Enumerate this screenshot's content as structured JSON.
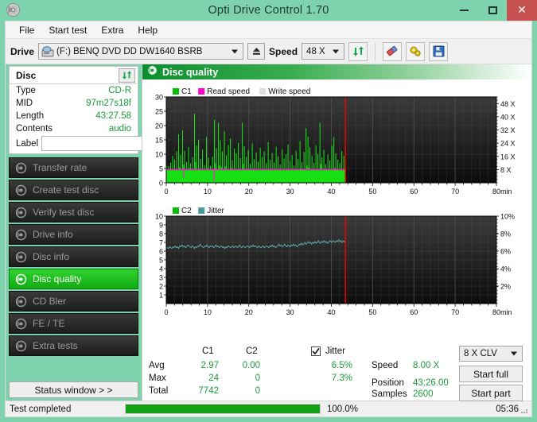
{
  "window": {
    "title": "Opti Drive Control 1.70",
    "app_icon": "disc-icon",
    "minimize": "minimize-icon",
    "maximize": "maximize-icon",
    "close": "close-icon"
  },
  "menu": {
    "items": [
      {
        "label": "File"
      },
      {
        "label": "Start test"
      },
      {
        "label": "Extra"
      },
      {
        "label": "Help"
      }
    ]
  },
  "toolbar": {
    "drive_label": "Drive",
    "drive_value": "(F:)   BENQ DVD DD DW1640 BSRB",
    "eject_icon": "eject-icon",
    "speed_label": "Speed",
    "speed_value": "48 X",
    "refresh_icon": "refresh-icon",
    "erase_icon": "eraser-icon",
    "settings_icon": "gears-icon",
    "save_icon": "save-icon"
  },
  "disc_panel": {
    "title": "Disc",
    "refresh_icon": "refresh-icon",
    "rows": [
      {
        "key": "Type",
        "value": "CD-R"
      },
      {
        "key": "MID",
        "value": "97m27s18f"
      },
      {
        "key": "Length",
        "value": "43:27.58"
      },
      {
        "key": "Contents",
        "value": "audio"
      }
    ],
    "label_key": "Label",
    "label_value": "",
    "label_placeholder": "",
    "label_button_icon": "cd-icon"
  },
  "nav": {
    "items": [
      {
        "label": "Transfer rate",
        "icon": "disc-icon",
        "active": false
      },
      {
        "label": "Create test disc",
        "icon": "disc-icon",
        "active": false
      },
      {
        "label": "Verify test disc",
        "icon": "disc-icon",
        "active": false
      },
      {
        "label": "Drive info",
        "icon": "disc-icon",
        "active": false
      },
      {
        "label": "Disc info",
        "icon": "disc-icon",
        "active": false
      },
      {
        "label": "Disc quality",
        "icon": "disc-icon",
        "active": true
      },
      {
        "label": "CD Bler",
        "icon": "disc-icon",
        "active": false
      },
      {
        "label": "FE / TE",
        "icon": "disc-icon",
        "active": false
      },
      {
        "label": "Extra tests",
        "icon": "disc-icon",
        "active": false
      }
    ],
    "status_window_label": "Status window > >"
  },
  "section": {
    "title": "Disc quality",
    "icon": "disc-icon"
  },
  "stats": {
    "col_c1": "C1",
    "col_c2": "C2",
    "col_jitter": "Jitter",
    "jitter_checked": true,
    "rows": [
      {
        "label": "Avg",
        "c1": "2.97",
        "c2": "0.00",
        "jitter": "6.5%"
      },
      {
        "label": "Max",
        "c1": "24",
        "c2": "0",
        "jitter": "7.3%"
      },
      {
        "label": "Total",
        "c1": "7742",
        "c2": "0",
        "jitter": ""
      }
    ],
    "speed_key": "Speed",
    "speed_value": "8.00 X",
    "position_key": "Position",
    "position_value": "43:26.00",
    "samples_key": "Samples",
    "samples_value": "2600",
    "speed_select": "8 X CLV",
    "start_full": "Start full",
    "start_part": "Start part"
  },
  "statusbar": {
    "text": "Test completed",
    "progress_pct": 100,
    "progress_label": "100.0%",
    "elapsed": "05:36"
  },
  "chart_data": [
    {
      "type": "bar",
      "id": "c1-chart",
      "title": "",
      "xlabel": "min",
      "ylabel": "",
      "xlim": [
        0,
        80
      ],
      "ylim": [
        0,
        30
      ],
      "ylim_right": [
        0,
        52
      ],
      "xticks": [
        0,
        10,
        20,
        30,
        40,
        50,
        60,
        70,
        80
      ],
      "yticks": [
        0,
        5,
        10,
        15,
        20,
        25,
        30
      ],
      "yticks_right": [
        "8 X",
        "16 X",
        "24 X",
        "32 X",
        "40 X",
        "48 X"
      ],
      "yticks_right_values": [
        8,
        16,
        24,
        32,
        40,
        48
      ],
      "grid": true,
      "legend": [
        {
          "name": "C1",
          "color": "#00c000"
        },
        {
          "name": "Read speed",
          "color": "#ff00c8"
        },
        {
          "name": "Write speed",
          "color": "#e0e0e0"
        }
      ],
      "marker_x": 43.4,
      "marker_color": "#ff0000",
      "data_end_x": 43.4,
      "baseline_fill_value": 4.4,
      "read_speed_value": 8.0,
      "values": [
        6.0,
        2.1,
        5.9,
        1.8,
        7.0,
        3.2,
        9.4,
        2.6,
        8.1,
        3.0,
        11.0,
        4.2,
        17.0,
        5.4,
        9.8,
        3.1,
        18.3,
        6.4,
        11.2,
        4.0,
        7.3,
        2.8,
        12.5,
        5.1,
        6.8,
        2.2,
        9.0,
        3.4,
        24.2,
        7.2,
        13.0,
        4.6,
        15.1,
        5.0,
        8.4,
        2.9,
        11.6,
        3.8,
        6.2,
        1.9,
        16.0,
        5.2,
        8.8,
        3.3,
        5.9,
        2.0,
        9.2,
        3.0,
        22.0,
        6.8,
        12.1,
        4.4,
        21.0,
        6.1,
        14.8,
        5.5,
        11.0,
        3.6,
        18.0,
        5.8,
        9.6,
        3.1,
        13.2,
        4.7,
        15.5,
        5.2,
        7.9,
        2.4,
        12.0,
        4.1,
        10.2,
        3.5,
        14.0,
        4.8,
        8.6,
        2.7,
        21.0,
        6.6,
        12.8,
        4.3,
        9.1,
        3.0,
        11.4,
        3.9,
        6.6,
        2.2,
        13.8,
        4.9,
        8.2,
        2.8,
        10.6,
        3.4,
        7.4,
        2.5,
        12.2,
        4.0,
        9.0,
        3.1,
        11.0,
        3.7,
        6.8,
        2.3,
        14.2,
        4.6,
        8.0,
        2.6,
        10.4,
        3.5,
        7.1,
        2.4,
        12.6,
        4.2,
        9.3,
        3.0,
        6.4,
        2.1,
        11.8,
        3.8,
        8.5,
        2.9,
        10.0,
        3.3,
        13.4,
        4.5,
        7.6,
        2.5,
        9.7,
        3.2,
        6.0,
        2.0,
        11.2,
        3.7,
        8.3,
        2.7,
        14.6,
        4.9,
        7.2,
        2.4,
        10.8,
        3.6,
        19.1,
        6.0,
        16.2,
        5.3,
        12.4,
        4.1,
        9.5,
        3.1,
        7.0,
        2.3,
        13.0,
        4.4,
        10.1,
        3.4,
        21.0,
        6.5,
        8.9,
        2.9,
        11.5,
        3.8,
        6.5,
        2.1,
        9.9,
        3.2,
        7.8,
        2.6,
        12.9,
        4.3,
        16.0,
        5.2,
        10.3,
        3.4,
        8.1,
        2.7,
        6.9,
        2.2,
        11.1,
        3.6,
        9.4,
        3.0
      ]
    },
    {
      "type": "line",
      "id": "jitter-chart",
      "title": "",
      "xlabel": "min",
      "ylabel": "",
      "xlim": [
        0,
        80
      ],
      "ylim": [
        0,
        10
      ],
      "ylim_right": [
        0,
        10
      ],
      "xticks": [
        0,
        10,
        20,
        30,
        40,
        50,
        60,
        70,
        80
      ],
      "yticks": [
        1,
        2,
        3,
        4,
        5,
        6,
        7,
        8,
        9,
        10
      ],
      "yticks_right": [
        "2%",
        "4%",
        "6%",
        "8%",
        "10%"
      ],
      "yticks_right_values": [
        2,
        4,
        6,
        8,
        10
      ],
      "grid": true,
      "legend": [
        {
          "name": "C2",
          "color": "#00c000"
        },
        {
          "name": "Jitter",
          "color": "#4a9a9a"
        }
      ],
      "marker_x": 43.4,
      "marker_color": "#ff0000",
      "data_end_x": 43.4,
      "series": [
        {
          "name": "Jitter",
          "color": "#5fa8a8",
          "values": [
            6.3,
            6.4,
            6.3,
            6.5,
            6.4,
            6.3,
            6.5,
            6.4,
            6.6,
            6.4,
            6.5,
            6.3,
            6.6,
            6.5,
            6.7,
            6.5,
            6.6,
            6.4,
            6.5,
            6.7,
            6.6,
            6.5,
            6.4,
            6.6,
            6.5,
            6.3,
            6.5,
            6.4,
            6.6,
            6.5,
            6.8,
            6.6,
            6.5,
            6.4,
            6.6,
            6.5,
            6.7,
            6.5,
            6.4,
            6.6,
            6.5,
            6.6,
            6.4,
            6.5,
            6.7,
            6.5,
            6.6,
            6.4,
            6.5,
            6.6,
            6.4,
            6.5,
            6.3,
            6.5,
            6.4,
            6.6,
            6.5,
            6.4,
            6.5,
            6.6,
            6.4,
            6.5,
            6.6,
            6.4,
            6.5,
            6.7,
            6.5,
            6.4,
            6.6,
            6.5,
            6.4,
            6.5,
            6.6,
            6.5,
            6.4,
            6.6,
            6.5,
            6.7,
            6.5,
            6.6,
            6.5,
            6.4,
            6.6,
            6.5,
            6.4,
            6.5,
            6.6,
            6.4,
            6.5,
            6.6,
            6.5,
            6.4,
            6.6,
            6.5,
            6.7,
            6.5,
            6.6,
            6.4,
            6.5,
            6.6,
            6.8,
            6.6,
            6.7,
            6.5,
            6.6,
            6.8,
            6.6,
            6.5,
            6.7,
            6.6,
            6.5,
            6.7,
            6.6,
            6.8,
            6.6,
            6.7,
            6.5,
            6.6,
            6.8,
            6.7,
            6.9,
            6.7,
            6.8,
            7.0,
            6.8,
            6.9,
            7.1,
            6.9,
            7.0,
            6.8,
            7.0,
            6.9,
            7.1,
            6.9,
            7.0,
            7.2,
            7.0,
            6.9,
            7.1,
            7.0,
            7.2,
            7.0,
            7.1,
            6.9,
            7.0,
            7.2,
            7.1,
            7.0,
            7.2,
            7.1,
            7.0,
            7.2,
            7.1,
            7.3,
            7.1,
            7.2,
            7.0,
            7.2,
            7.1,
            7.0
          ]
        }
      ]
    }
  ]
}
